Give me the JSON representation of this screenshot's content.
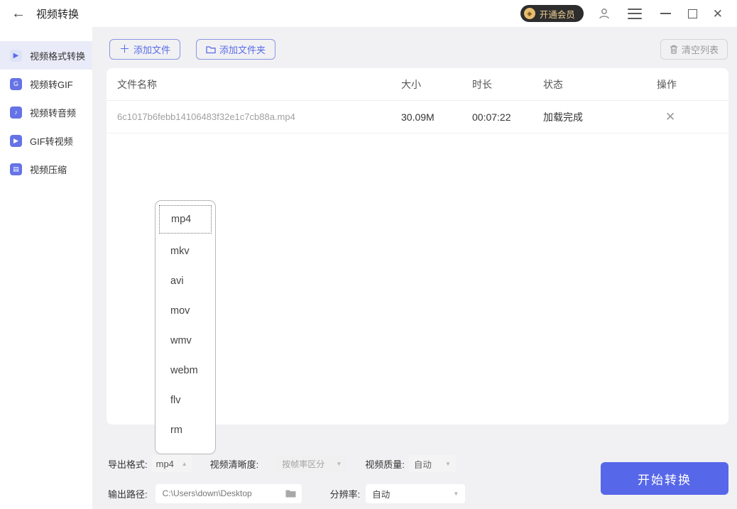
{
  "titlebar": {
    "title": "视频转换",
    "vip_label": "开通会员"
  },
  "icons": {
    "back": "←",
    "close": "✕",
    "vip_gem": "◆",
    "plus": "＋",
    "folder_outline": "🗀",
    "caret_up": "▲",
    "caret_down": "▼",
    "row_close": "✕",
    "sidebar_play": "▶",
    "sidebar_gif": "G",
    "sidebar_audio": "♪",
    "sidebar_gif2video": "▶",
    "sidebar_compress": "▤"
  },
  "sidebar": {
    "items": [
      {
        "label": "视频格式转换",
        "active": true
      },
      {
        "label": "视频转GIF",
        "active": false
      },
      {
        "label": "视频转音频",
        "active": false
      },
      {
        "label": "GIF转视频",
        "active": false
      },
      {
        "label": "视频压缩",
        "active": false
      }
    ]
  },
  "toolbar": {
    "add_file": "添加文件",
    "add_folder": "添加文件夹",
    "clear_list": "清空列表"
  },
  "table": {
    "headers": [
      "文件名称",
      "大小",
      "时长",
      "状态",
      "操作"
    ],
    "rows": [
      {
        "name": "6c1017b6febb14106483f32e1c7cb88a.mp4",
        "size": "30.09M",
        "duration": "00:07:22",
        "status": "加载完成"
      }
    ]
  },
  "format_dropdown": {
    "selected": "mp4",
    "options": [
      "mp4",
      "mkv",
      "avi",
      "mov",
      "wmv",
      "webm",
      "flv",
      "rm"
    ]
  },
  "settings": {
    "export_format_label": "导出格式:",
    "export_format_value": "mp4",
    "clarity_label": "视频清晰度:",
    "clarity_value": "按帧率区分",
    "quality_label": "视频质量:",
    "quality_value": "自动",
    "output_path_label": "输出路径:",
    "output_path_value": "C:\\Users\\down\\Desktop",
    "resolution_label": "分辨率:",
    "resolution_value": "自动"
  },
  "actions": {
    "start_label": "开始转换"
  },
  "colors": {
    "accent": "#5a6be8",
    "start_button": "#5767e9",
    "active_item_bg": "#e9ebf8",
    "vip_badge_bg": "#2d2d2d",
    "vip_gold": "#eccd92",
    "content_bg": "#f1f1f3"
  }
}
